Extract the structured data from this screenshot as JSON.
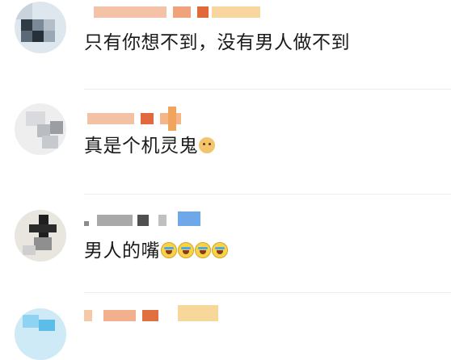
{
  "comments": [
    {
      "text": "只有你想不到，没有男人做不到",
      "emoji": []
    },
    {
      "text": "真是个机灵鬼",
      "emoji": [
        "doge-icon"
      ]
    },
    {
      "text": "男人的嘴",
      "emoji": [
        "laugh-cry-icon",
        "laugh-cry-icon",
        "laugh-cry-icon",
        "laugh-cry-icon"
      ]
    },
    {
      "text": "",
      "emoji": []
    }
  ]
}
